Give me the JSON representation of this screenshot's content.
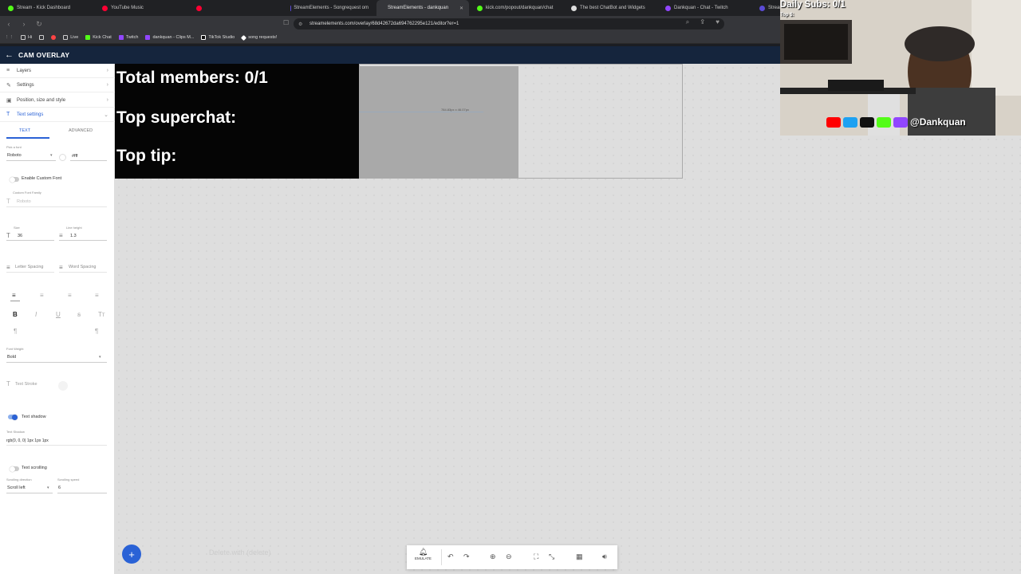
{
  "browser": {
    "tabs": [
      {
        "label": "Stream - Kick Dashboard",
        "color": "#53fc18"
      },
      {
        "label": "YouTube Music",
        "color": "#ff0033"
      },
      {
        "label": "",
        "color": "#ff0033"
      },
      {
        "label": "StreamElements - Songrequest om",
        "color": "#5b4bd6"
      },
      {
        "label": "StreamElements - dankquan",
        "color": "#5b4bd6"
      },
      {
        "label": "kick.com/popout/dankquan/chat",
        "color": "#53fc18"
      },
      {
        "label": "The best ChatBot and Widgets",
        "color": "#dddddd"
      },
      {
        "label": "Dankquan - Chat - Twitch",
        "color": "#9146ff"
      },
      {
        "label": "Stream",
        "color": "#5b4bd6"
      }
    ],
    "url": "streamelements.com/overlay/68d42672da694762295e121/editor?er=1",
    "bookmarks": [
      {
        "label": "Hi",
        "color": "#888888"
      },
      {
        "label": "",
        "color": "#888888"
      },
      {
        "label": "",
        "color": "#ff4444"
      },
      {
        "label": "Live",
        "color": "#ff4444"
      },
      {
        "label": "Kick Chat",
        "color": "#53fc18"
      },
      {
        "label": "Twitch",
        "color": "#9146ff"
      },
      {
        "label": "dankquan - Clips M...",
        "color": "#9146ff"
      },
      {
        "label": "TikTok Studio",
        "color": "#ffffff"
      },
      {
        "label": "song requests!",
        "color": "#ffffff"
      }
    ]
  },
  "editor": {
    "title": "CAM OVERLAY",
    "back_icon": "arrow-left-icon"
  },
  "sidebar": {
    "sections": [
      {
        "label": "Layers",
        "icon": "layers-icon"
      },
      {
        "label": "Settings",
        "icon": "wrench-icon"
      },
      {
        "label": "Position, size and style",
        "icon": "position-icon"
      },
      {
        "label": "Text settings",
        "icon": "text-icon"
      }
    ],
    "sub_tabs": {
      "text": "TEXT",
      "advanced": "ADVANCED"
    },
    "font_label": "Pick a font",
    "font_value": "Roboto",
    "color_value": "#fff",
    "custom_font_toggle": "Enable Custom Font",
    "custom_font_label": "Custom Font Family",
    "custom_font_placeholder": "Roboto",
    "size_label": "Size",
    "size_value": "36",
    "line_height_label": "Line height",
    "line_height_value": "1.3",
    "letter_spacing": "Letter Spacing",
    "word_spacing": "Word Spacing",
    "font_weight_label": "Font Weight",
    "font_weight_value": "Bold",
    "text_stroke": "Text Stroke",
    "text_shadow_toggle": "Text shadow",
    "text_shadow_label": "Text Shadow",
    "text_shadow_value": "rgb(0, 0, 0) 1px 1px 1px",
    "text_scrolling_toggle": "Text scrolling",
    "scroll_direction_label": "Scrolling direction",
    "scroll_direction_value": "Scroll left",
    "scroll_speed_label": "Scrolling speed",
    "scroll_speed_value": "6"
  },
  "canvas": {
    "lines": [
      "Total members: 0/1",
      "Top superchat:",
      "Top tip:"
    ],
    "dims_readout": "784.83px x 46.07px",
    "hint": "Delete with (delete)"
  },
  "webcam": {
    "daily_subs": "Daily Subs: 0/1",
    "top_line": "Top $:",
    "handle": "@Dankquan"
  },
  "toolbar": {
    "emulate": "EMULATE"
  },
  "colors": {
    "accent": "#2a62d6",
    "header_bg": "#15253d"
  }
}
